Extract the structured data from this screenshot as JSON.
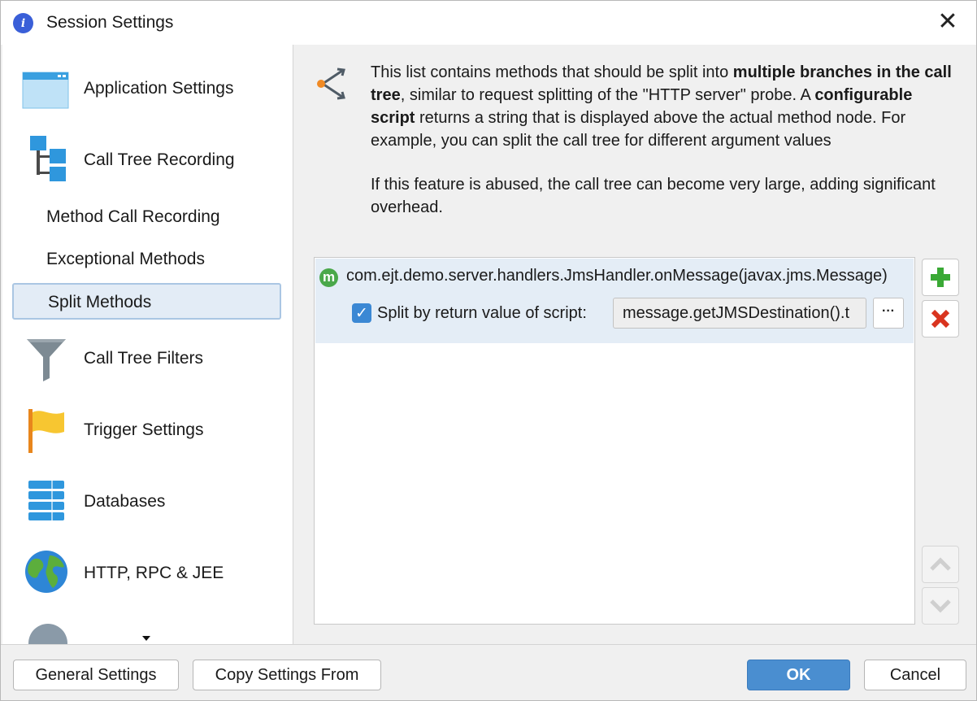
{
  "window": {
    "title": "Session Settings",
    "close_glyph": "✕"
  },
  "sidebar": {
    "items": [
      {
        "label": "Application Settings",
        "icon": "window-icon"
      },
      {
        "label": "Call Tree Recording",
        "icon": "tree-icon"
      },
      {
        "label": "Method Call Recording"
      },
      {
        "label": "Exceptional Methods"
      },
      {
        "label": "Split Methods",
        "selected": true
      },
      {
        "label": "Call Tree Filters",
        "icon": "funnel-icon"
      },
      {
        "label": "Trigger Settings",
        "icon": "flag-icon"
      },
      {
        "label": "Databases",
        "icon": "database-icon"
      },
      {
        "label": "HTTP, RPC & JEE",
        "icon": "globe-icon"
      }
    ]
  },
  "content": {
    "desc": {
      "p1_a": "This list contains methods that should be split into ",
      "p1_b": "multiple branches in the call tree",
      "p1_c": ", similar to request splitting of the \"HTTP server\" probe. A ",
      "p1_d": "configurable script",
      "p1_e": " returns a string that is displayed above the actual method node. For example, you can split the call tree for different argument values",
      "p2": "If this feature is abused, the call tree can become very large, adding significant overhead."
    },
    "list": {
      "method_icon_letter": "m",
      "method": "com.ejt.demo.server.handlers.JmsHandler.onMessage(javax.jms.Message)",
      "checkbox_checked": true,
      "checkbox_glyph": "✓",
      "checkbox_label": "Split by return value of script:",
      "script_value": "message.getJMSDestination().t",
      "dots_label": "···"
    }
  },
  "footer": {
    "general_settings": "General Settings",
    "copy_settings": "Copy Settings From",
    "ok": "OK",
    "cancel": "Cancel"
  },
  "colors": {
    "accent": "#4a8ed0",
    "selection": "#e3ecf6",
    "add_green": "#3aa935",
    "delete_red": "#d9341f"
  }
}
